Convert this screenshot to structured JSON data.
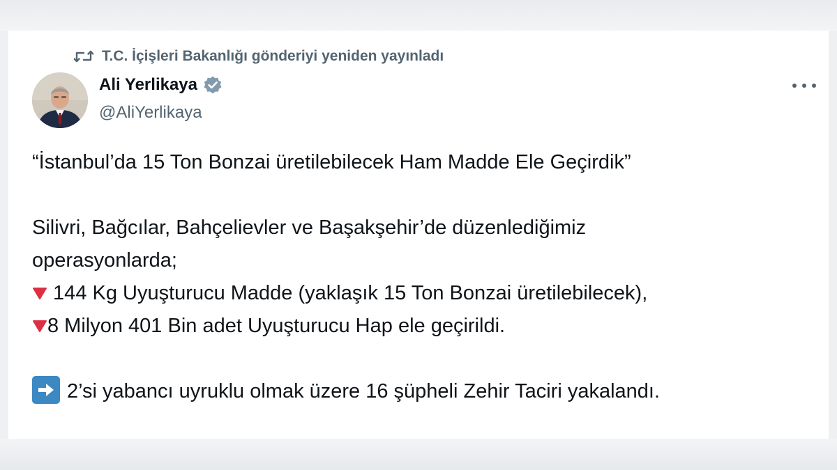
{
  "retweet": {
    "label": "T.C. İçişleri Bakanlığı gönderiyi yeniden yayınladı",
    "icon": "retweet-icon"
  },
  "author": {
    "name": "Ali Yerlikaya",
    "handle": "@AliYerlikaya",
    "verified_icon": "verified-badge-icon",
    "verified_color": "#829aab"
  },
  "tweet": {
    "headline": "“İstanbul’da 15 Ton Bonzai üretilebilecek Ham Madde Ele Geçirdik”",
    "intro_line1": "Silivri, Bağcılar, Bahçelievler ve Başakşehir’de düzenlediğimiz",
    "intro_line2": "operasyonlarda;",
    "bullet1": " 144 Kg Uyuşturucu Madde (yaklaşık 15 Ton Bonzai üretilebilecek),",
    "bullet2": "8 Milyon 401 Bin adet Uyuşturucu Hap ele geçirildi.",
    "closing": "2’si yabancı uyruklu olmak üzere 16 şüpheli Zehir Taciri yakalandı.",
    "bullet_icon": "red-triangle-down-icon",
    "bullet_color": "#dd2e44",
    "closing_icon": "right-arrow-box-icon",
    "closing_icon_color": "#3b88c3"
  },
  "colors": {
    "text_primary": "#0f1419",
    "text_secondary": "#536471",
    "background": "#ffffff"
  }
}
